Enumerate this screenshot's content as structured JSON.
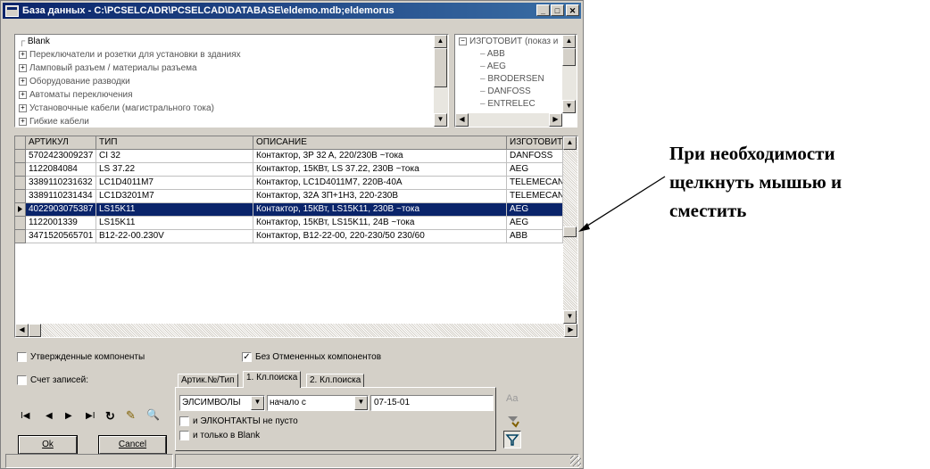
{
  "window": {
    "title": "База данных - C:\\PCSELCADR\\PCSELCAD\\DATABASE\\eldemo.mdb;eldemorus",
    "buttons": {
      "minimize": "_",
      "maximize": "□",
      "close": "✕"
    }
  },
  "tree": {
    "items": [
      {
        "label": "Blank",
        "expandable": false
      },
      {
        "label": "Переключатели и розетки для установки в зданиях",
        "expandable": true
      },
      {
        "label": "Ламповый разъем / материалы разъема",
        "expandable": true
      },
      {
        "label": "Оборудование разводки",
        "expandable": true
      },
      {
        "label": "Автоматы переключения",
        "expandable": true
      },
      {
        "label": "Установочные кабели (магистрального тока)",
        "expandable": true
      },
      {
        "label": "Гибкие кабели",
        "expandable": true
      }
    ]
  },
  "manufacturer_tree": {
    "root": "ИЗГОТОВИТ (показ и",
    "items": [
      "ABB",
      "AEG",
      "BRODERSEN",
      "DANFOSS",
      "ENTRELEC"
    ]
  },
  "grid": {
    "columns": [
      "АРТИКУЛ",
      "ТИП",
      "ОПИСАНИЕ",
      "ИЗГОТОВИТ"
    ],
    "rows": [
      [
        "5702423009237",
        "CI 32",
        "Контактор, 3P 32 A, 220/230В ~тока",
        "DANFOSS"
      ],
      [
        "1122084084",
        "LS 37.22",
        "Контактор, 15КВт, LS 37.22, 230В ~тока",
        "AEG"
      ],
      [
        "3389110231632",
        "LC1D4011M7",
        "Контактор, LC1D4011M7, 220В-40А",
        "TELEMECAN"
      ],
      [
        "3389110231434",
        "LC1D3201M7",
        "Контактор, 32А 3П+1Н3, 220-230В",
        "TELEMECAN"
      ],
      [
        "4022903075387",
        "LS15K11",
        "Контактор, 15КВт, LS15K11, 230В ~тока",
        "AEG"
      ],
      [
        "1122001339",
        "LS15K11",
        "Контактор, 15КВт, LS15K11, 24В ~тока",
        "AEG"
      ],
      [
        "3471520565701",
        "B12-22-00.230V",
        "Контактор, B12-22-00, 220-230/50 230/60",
        "ABB"
      ]
    ],
    "selected_row": 4
  },
  "options": {
    "approved_components": "Утвержденные компоненты",
    "approved_checked": false,
    "without_cancelled": "Без Отмененных компонентов",
    "without_cancelled_checked": true,
    "record_count": "Счет записей:",
    "record_count_checked": false
  },
  "navigator": {
    "first": "I◀",
    "prev": "◀",
    "next": "▶",
    "last": "▶I",
    "refresh": "↻",
    "edit": "✎",
    "find": "🔍"
  },
  "buttons": {
    "ok": "Ok",
    "cancel": "Cancel"
  },
  "search": {
    "tabs": [
      "Артик.№/Тип",
      "1. Кл.поиска",
      "2. Кл.поиска"
    ],
    "active_tab": 1,
    "field_value": "ЭЛСИМВОЛЫ",
    "mode_value": "начало с",
    "query_value": "07-15-01",
    "chk_contacts": "и ЭЛКОНТАКТЫ не пусто",
    "chk_blank": "и только в Blank",
    "case_label": "Aa"
  },
  "annotation": {
    "line1": "При необходимости",
    "line2": "щелкнуть мышью и",
    "line3": "сместить"
  }
}
